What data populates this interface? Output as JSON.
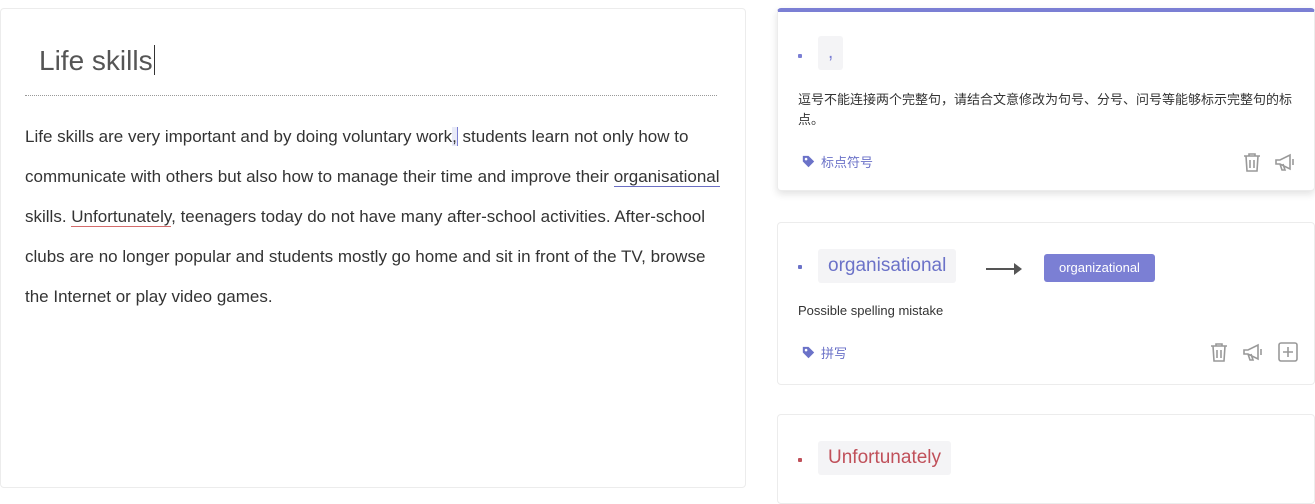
{
  "editor": {
    "title": "Life skills",
    "paragraph": [
      {
        "text": "Life skills are very important and by doing voluntary work"
      },
      {
        "text": ",",
        "mark": "comma"
      },
      {
        "text": " students learn not only how to communicate with others but also how to manage their time and improve their "
      },
      {
        "text": "organisational",
        "mark": "org"
      },
      {
        "text": " skills. "
      },
      {
        "text": "Unfortunately",
        "mark": "unf"
      },
      {
        "text": ", teenagers today do not have many after-school activities. After-school clubs are no longer popular and students mostly go home and sit in front of the TV, browse the Internet or play video games."
      }
    ]
  },
  "cards": [
    {
      "token": ",",
      "description": "逗号不能连接两个完整句，请结合文意修改为句号、分号、问号等能够标示完整句的标点。",
      "tag": "标点符号",
      "color": "#7b7fd4"
    },
    {
      "token": "organisational",
      "suggestion": "organizational",
      "description": "Possible spelling mistake",
      "tag": "拼写",
      "color": "#6b72c8"
    },
    {
      "token": "Unfortunately",
      "color": "#c0505a"
    }
  ]
}
